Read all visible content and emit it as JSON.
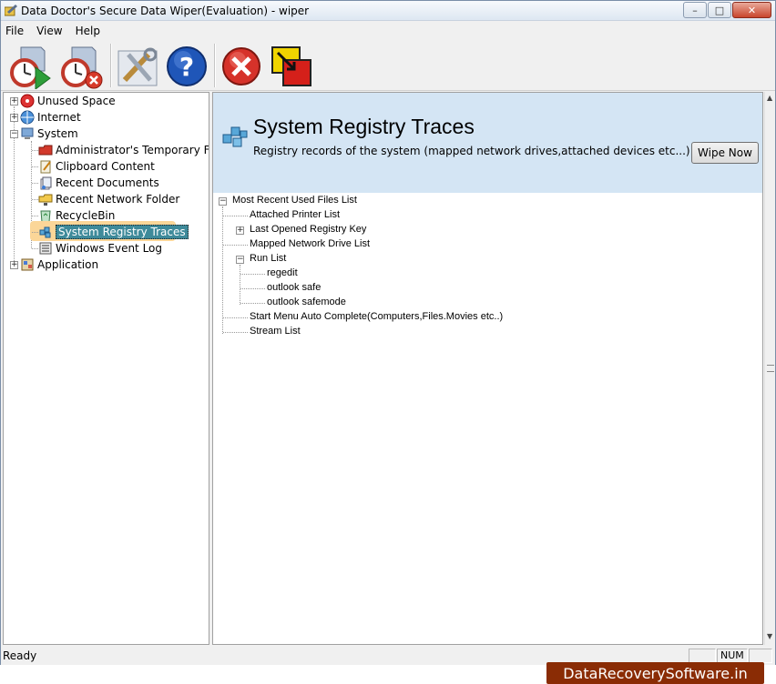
{
  "window": {
    "title": "Data Doctor's Secure Data Wiper(Evaluation) - wiper",
    "controls": {
      "minimize": "–",
      "maximize": "□",
      "close": "✕"
    }
  },
  "menu": [
    "File",
    "View",
    "Help"
  ],
  "toolbar": {
    "buttons": [
      {
        "name": "start-wipe-icon"
      },
      {
        "name": "stop-schedule-icon"
      },
      {
        "name": "settings-tools-icon"
      },
      {
        "name": "help-icon"
      },
      {
        "name": "exit-icon"
      },
      {
        "name": "about-icon"
      }
    ]
  },
  "left_tree": {
    "items": [
      {
        "label": "Unused Space",
        "expander": "+",
        "icon": "disk-icon"
      },
      {
        "label": "Internet",
        "expander": "+",
        "icon": "globe-icon"
      },
      {
        "label": "System",
        "expander": "−",
        "icon": "computer-icon"
      },
      {
        "label": "Administrator's Temporary Files",
        "icon": "folder-red-icon"
      },
      {
        "label": "Clipboard Content",
        "icon": "clipboard-icon"
      },
      {
        "label": "Recent Documents",
        "icon": "documents-icon"
      },
      {
        "label": "Recent Network Folder",
        "icon": "network-folder-icon"
      },
      {
        "label": "RecycleBin",
        "icon": "recycle-bin-icon"
      },
      {
        "label": "System Registry Traces",
        "icon": "registry-icon",
        "selected": true
      },
      {
        "label": "Windows Event Log",
        "icon": "event-log-icon"
      },
      {
        "label": "Application",
        "expander": "+",
        "icon": "application-icon"
      }
    ]
  },
  "right_pane": {
    "header_title": "System Registry Traces",
    "header_desc": "Registry records of the system (mapped network drives,attached devices etc...)",
    "wipe_now_label": "Wipe Now",
    "tree": [
      {
        "label": "Most Recent Used Files List",
        "expander": "−"
      },
      {
        "label": "Attached Printer List"
      },
      {
        "label": "Last Opened Registry Key",
        "expander": "+"
      },
      {
        "label": "Mapped Network Drive List"
      },
      {
        "label": "Run List",
        "expander": "−"
      },
      {
        "label": "regedit"
      },
      {
        "label": "outlook safe"
      },
      {
        "label": "outlook safemode"
      },
      {
        "label": "Start Menu Auto Complete(Computers,Files.Movies etc..)"
      },
      {
        "label": "Stream List"
      }
    ]
  },
  "status": {
    "text": "Ready",
    "num": "NUM"
  },
  "brand": "DataRecoverySoftware.in"
}
